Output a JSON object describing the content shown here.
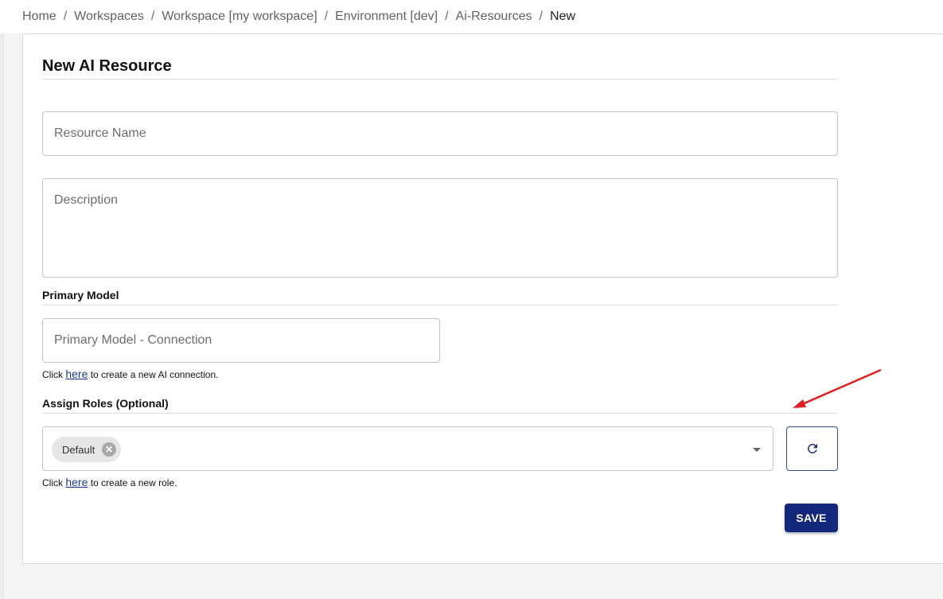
{
  "breadcrumb": {
    "items": [
      "Home",
      "Workspaces",
      "Workspace [my workspace]",
      "Environment [dev]",
      "Ai-Resources"
    ],
    "current": "New",
    "separator": "/"
  },
  "form": {
    "title": "New AI Resource",
    "resource_name_placeholder": "Resource Name",
    "description_placeholder": "Description",
    "primary_model_label": "Primary Model",
    "primary_model_placeholder": "Primary Model - Connection",
    "connection_helper": {
      "prefix": "Click",
      "link": "here",
      "suffix": "to create a new AI connection."
    },
    "roles_label": "Assign Roles (Optional)",
    "roles_selected": [
      "Default"
    ],
    "roles_helper": {
      "prefix": "Click",
      "link": "here",
      "suffix": "to create a new role."
    },
    "save_label": "SAVE"
  },
  "icons": {
    "chip_remove": "close-circle-icon",
    "dropdown": "caret-down-icon",
    "refresh": "refresh-icon"
  },
  "colors": {
    "primary": "#13287a",
    "link": "#1a3a8a",
    "annotation": "#e02020"
  }
}
